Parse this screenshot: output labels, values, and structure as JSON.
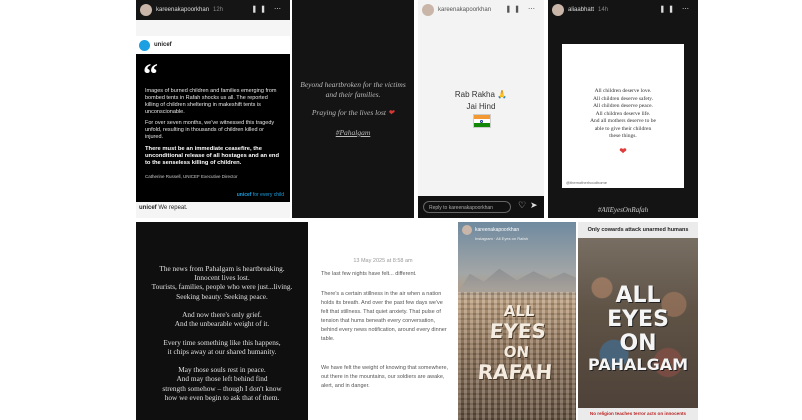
{
  "panel1": {
    "username": "kareenakapoorkhan",
    "time": "12h",
    "org_name": "unicef",
    "quote_mark": "“",
    "para1": "Images of burned children and families emerging from bombed tents in Rafah shocks us all. The reported killing of children sheltering in makeshift tents is unconscionable.",
    "para2": "For over seven months, we've witnessed this tragedy unfold, resulting in thousands of children killed or injured.",
    "bold": "There must be an immediate ceasefire, the unconditional release of all hostages and an end to the senseless killing of children.",
    "signature": "Catherine Russell, UNICEF Executive Director",
    "logo_text": "unicef",
    "tagline": "for every child",
    "caption_user": "unicef",
    "caption_text": "We repeat."
  },
  "panel2": {
    "line1": "Beyond heartbroken for the victims and their families.",
    "line2": "Praying for the lives lost",
    "heart": "❤",
    "hashtag": "#Pahalgam"
  },
  "panel3": {
    "username": "kareenakapoorkhan",
    "line1": "Rab Rakha 🙏",
    "line2": "Jai Hind",
    "flag": "🇮🇳",
    "reply_placeholder": "Reply to kareenakapoorkhan"
  },
  "panel4": {
    "username": "aliaabhatt",
    "time": "14h",
    "lines": [
      "All children deserve love.",
      "All children deserve safety.",
      "All children deserve peace.",
      "All children deserve life.",
      "And all mothers deserve to be",
      "able to give their children",
      "these things."
    ],
    "heart": "❤",
    "credit": "@themotherhoodhome",
    "hashtag": "#AllEyesOnRafah"
  },
  "panel5": {
    "lines": [
      "The news from Pahalgam is heartbreaking.",
      "Innocent lives lost.",
      "Tourists, families, people who were just...living.",
      "Seeking beauty. Seeking peace.",
      "",
      "And now there's only grief.",
      "And the unbearable weight of it.",
      "",
      "Every time something like this happens,",
      "it chips away at our shared humanity.",
      "",
      "May those souls rest in peace.",
      "And may those left behind find",
      "strength somehow – though I don't know",
      "how we even begin to ask that of them."
    ]
  },
  "panel6": {
    "date": "13 May 2025 at 8:58 am",
    "p1": "The last few nights have felt... different.",
    "p2": "There's a certain stillness in the air when a nation holds its breath. And over the past few days we've felt that stillness. That quiet anxiety. That pulse of tension that hums beneath every conversation, behind every news notification, around every dinner table.",
    "p3": "We have felt the weight of knowing that somewhere, out there in the mountains, our soldiers are awake, alert, and in danger."
  },
  "panel7": {
    "username": "kareenakapoorkhan",
    "subtitle": "Instagram · All Eyes on Rafah",
    "words": [
      "ALL",
      "EYES",
      "ON",
      "RAFAH"
    ]
  },
  "panel8": {
    "top_banner": "Only cowards attack unarmed humans",
    "words": [
      "ALL",
      "EYES",
      "ON",
      "PAHALGAM"
    ],
    "bottom_banner": "No religion teaches terror acts on innocents"
  },
  "colors": {
    "dark": "#0f0f0f",
    "unicef_blue": "#1ca0e1",
    "red_heart": "#d93636",
    "banner": "#ebebeb"
  }
}
